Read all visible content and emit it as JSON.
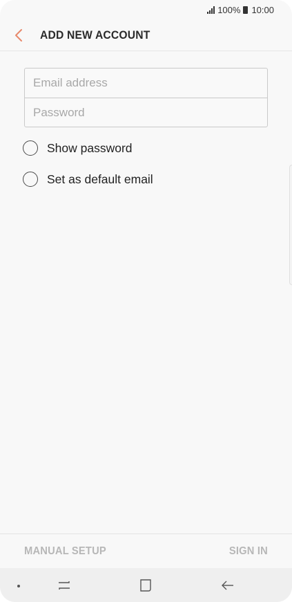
{
  "status_bar": {
    "battery": "100%",
    "time": "10:00"
  },
  "header": {
    "title": "ADD NEW ACCOUNT",
    "back_icon": "chevron-left-icon",
    "accent_color": "#e8896b"
  },
  "form": {
    "email": {
      "value": "",
      "placeholder": "Email address"
    },
    "password": {
      "value": "",
      "placeholder": "Password"
    }
  },
  "options": [
    {
      "label": "Show password",
      "checked": false
    },
    {
      "label": "Set as default email",
      "checked": false
    }
  ],
  "actions": {
    "manual_setup": "MANUAL SETUP",
    "sign_in": "SIGN IN"
  },
  "nav_bar": {
    "icons": [
      "recent-apps-icon",
      "home-icon",
      "back-arrow-icon"
    ]
  }
}
